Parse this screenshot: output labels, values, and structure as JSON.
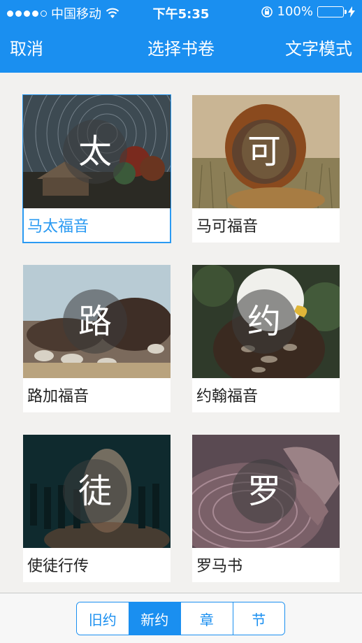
{
  "status": {
    "carrier": "中国移动",
    "time": "下午5:35",
    "battery": "100%",
    "battery_level": 1.0
  },
  "nav": {
    "cancel": "取消",
    "title": "选择书卷",
    "mode": "文字模式"
  },
  "books": [
    {
      "badge": "太",
      "name": "马太福音",
      "selected": true
    },
    {
      "badge": "可",
      "name": "马可福音",
      "selected": false
    },
    {
      "badge": "路",
      "name": "路加福音",
      "selected": false
    },
    {
      "badge": "约",
      "name": "约翰福音",
      "selected": false
    },
    {
      "badge": "徒",
      "name": "使徒行传",
      "selected": false
    },
    {
      "badge": "罗",
      "name": "罗马书",
      "selected": false
    }
  ],
  "tabs": [
    {
      "label": "旧约",
      "active": false
    },
    {
      "label": "新约",
      "active": true
    },
    {
      "label": "章",
      "active": false
    },
    {
      "label": "节",
      "active": false
    }
  ],
  "colors": {
    "accent": "#1a8ff0",
    "selected": "#2a9af2",
    "background": "#f2f1ef"
  }
}
